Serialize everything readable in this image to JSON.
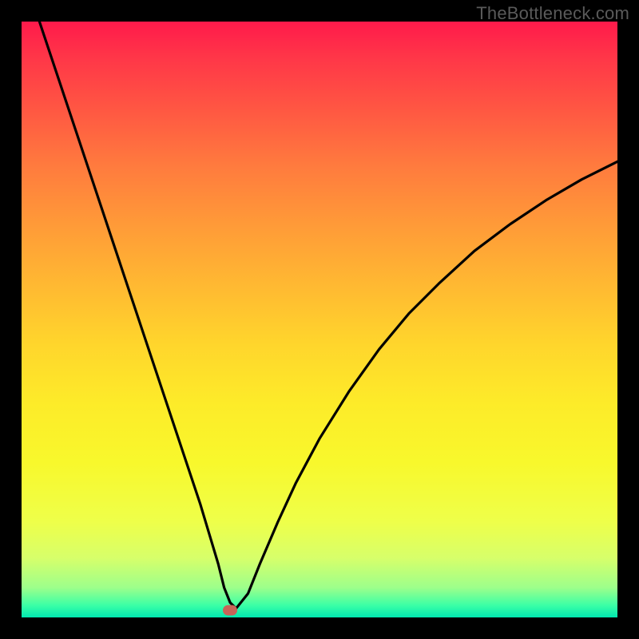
{
  "watermark": "TheBottleneck.com",
  "chart_data": {
    "type": "line",
    "title": "",
    "xlabel": "",
    "ylabel": "",
    "xlim": [
      0,
      100
    ],
    "ylim": [
      0,
      100
    ],
    "grid": false,
    "series": [
      {
        "name": "curve",
        "x": [
          3,
          6,
          9,
          12,
          15,
          18,
          21,
          24,
          27,
          30,
          31.5,
          33,
          34,
          35,
          36,
          38,
          40,
          43,
          46,
          50,
          55,
          60,
          65,
          70,
          76,
          82,
          88,
          94,
          100
        ],
        "values": [
          100,
          91,
          82,
          73,
          64,
          55,
          46,
          37,
          28,
          19,
          14,
          9,
          5,
          2.5,
          1.5,
          4,
          9,
          16,
          22.5,
          30,
          38,
          45,
          51,
          56,
          61.5,
          66,
          70,
          73.5,
          76.5
        ]
      }
    ],
    "marker": {
      "x": 35,
      "y": 1.2
    },
    "gradient_stops": [
      {
        "pct": 0,
        "color": "#ff1a4b"
      },
      {
        "pct": 50,
        "color": "#ffd02e"
      },
      {
        "pct": 100,
        "color": "#00e8b0"
      }
    ]
  }
}
